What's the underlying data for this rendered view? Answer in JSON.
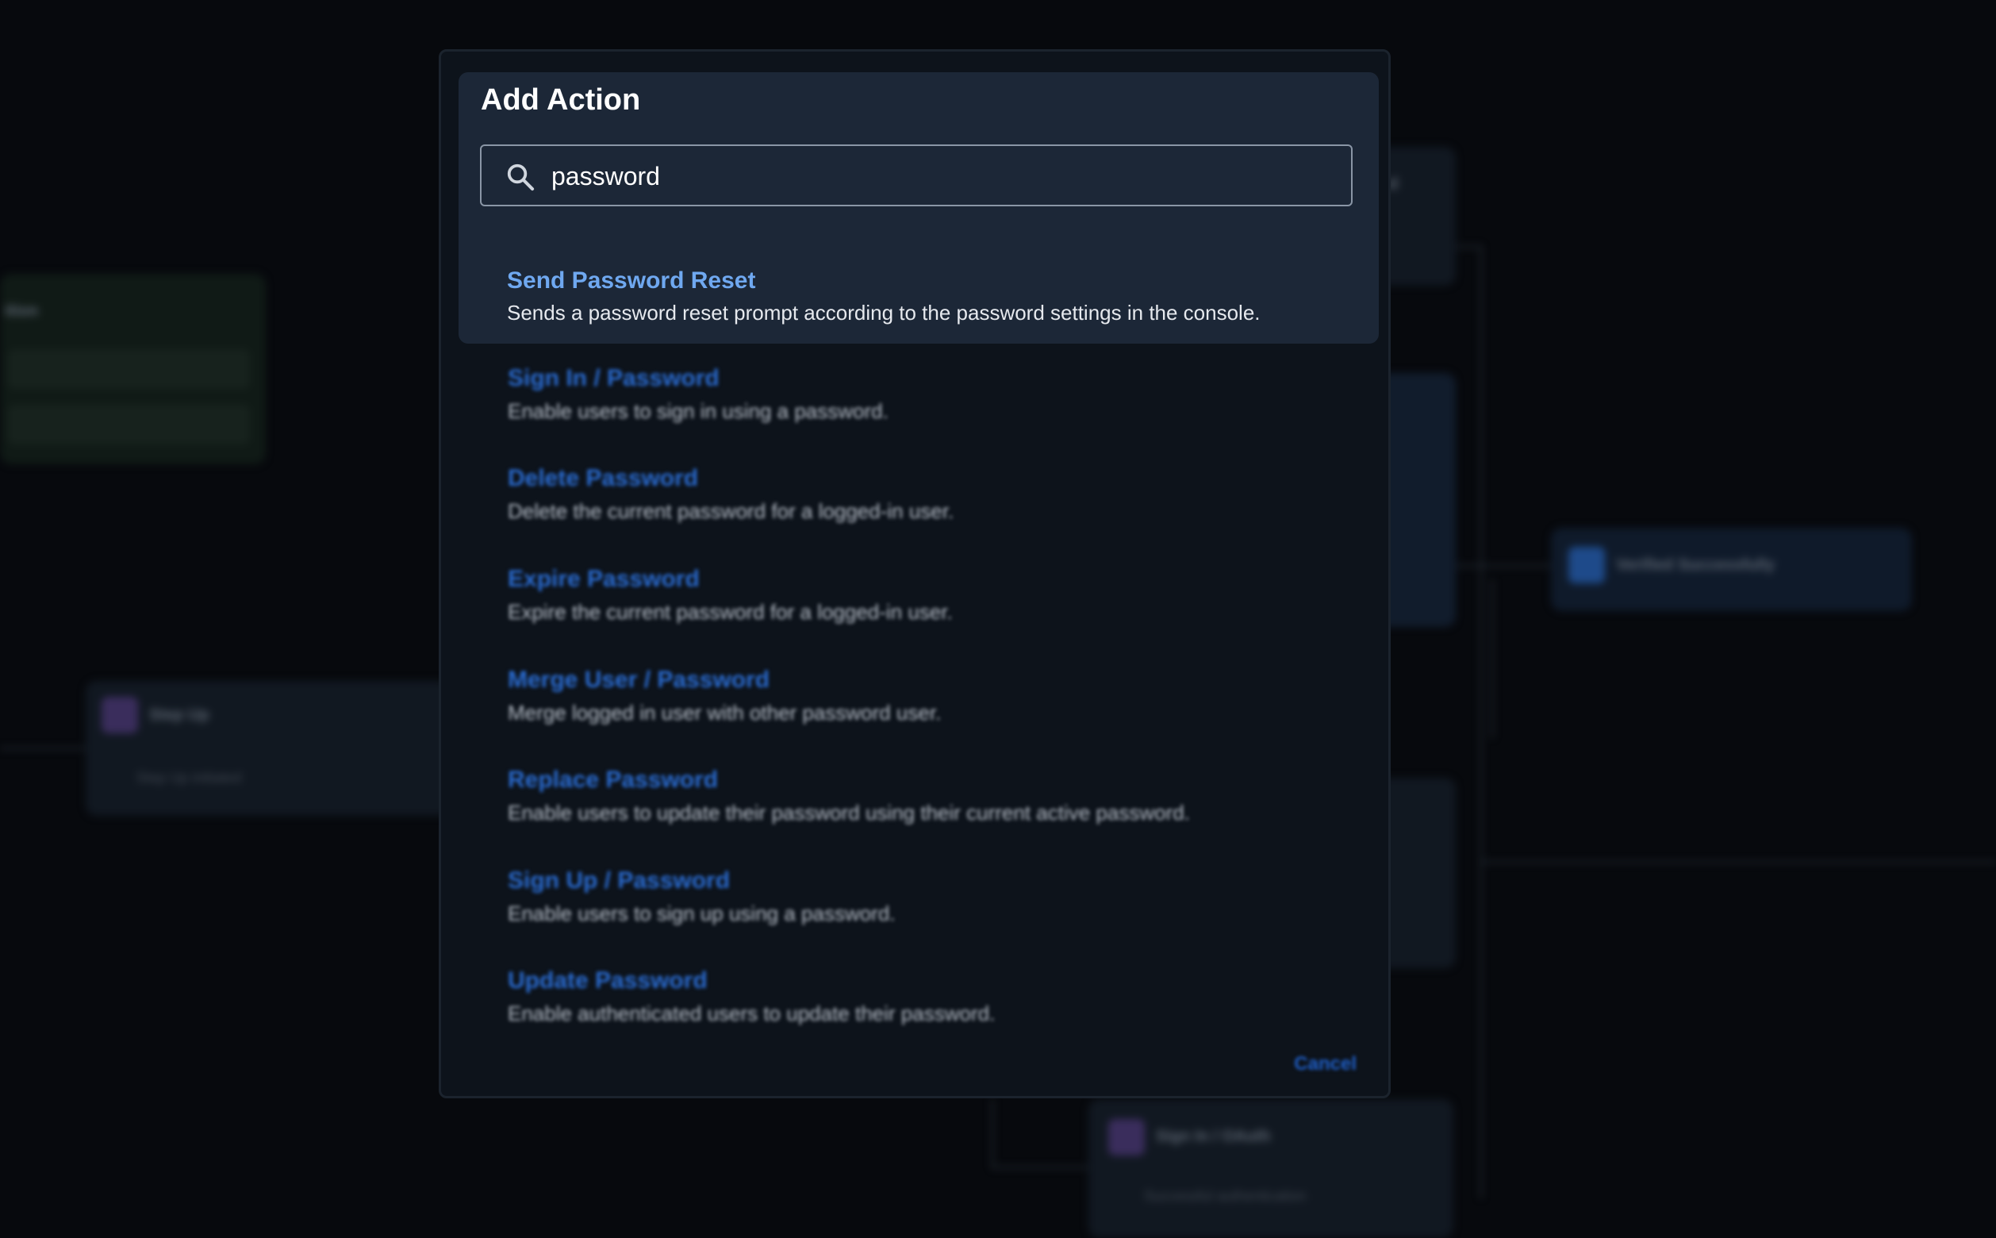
{
  "modal": {
    "title": "Add Action",
    "search": {
      "value": "password",
      "placeholder": ""
    },
    "highlighted": {
      "title": "Send Password Reset",
      "description": "Sends a password reset prompt according to the password settings in the console."
    },
    "results": [
      {
        "title": "Sign In / Password",
        "description": "Enable users to sign in using a password."
      },
      {
        "title": "Delete Password",
        "description": "Delete the current password for a logged-in user."
      },
      {
        "title": "Expire Password",
        "description": "Expire the current password for a logged-in user."
      },
      {
        "title": "Merge User / Password",
        "description": "Merge logged in user with other password user."
      },
      {
        "title": "Replace Password",
        "description": "Enable users to update their password using their current active password."
      },
      {
        "title": "Sign Up / Password",
        "description": "Enable users to sign up using a password."
      },
      {
        "title": "Update Password",
        "description": "Enable authenticated users to update their password."
      }
    ],
    "cancel_label": "Cancel"
  },
  "background": {
    "nodes": {
      "condition_label": "ition",
      "step_up_title": "Step Up",
      "step_up_sub": "Step Up initiated",
      "verified_title": "Verified Successfully",
      "oauth_title": "Sign In / OAuth",
      "oauth_sub": "Successful authentication",
      "partial_label": "d"
    }
  },
  "colors": {
    "highlight_title": "#6fa8f0",
    "result_title": "#2a6bd0",
    "modal_bg": "#0d131b",
    "highlight_bg": "#1c2737"
  },
  "icons": {
    "search": "search-icon"
  }
}
